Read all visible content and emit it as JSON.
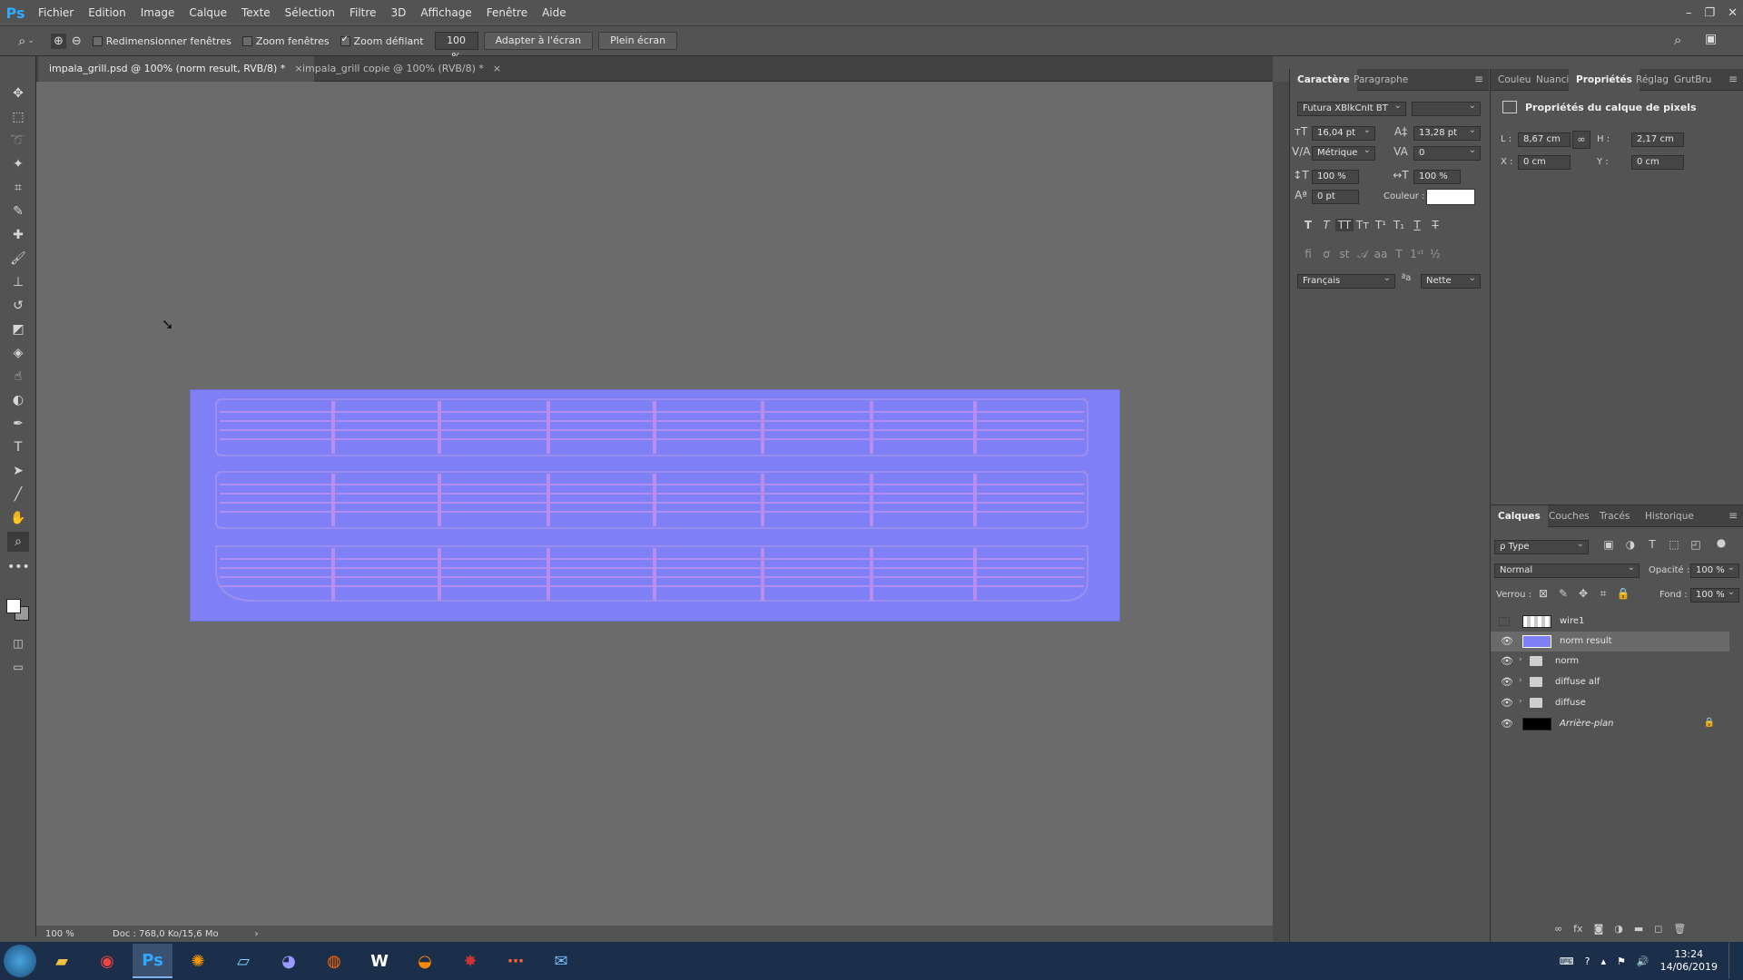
{
  "app": {
    "logo": "Ps"
  },
  "menu": [
    "Fichier",
    "Edition",
    "Image",
    "Calque",
    "Texte",
    "Sélection",
    "Filtre",
    "3D",
    "Affichage",
    "Fenêtre",
    "Aide"
  ],
  "window_controls": {
    "minimize": "–",
    "restore": "❐",
    "close": "✕"
  },
  "options": {
    "resize_windows": "Redimensionner fenêtres",
    "resize_windows_checked": false,
    "zoom_all": "Zoom fenêtres",
    "zoom_all_checked": false,
    "scrubby": "Zoom défilant",
    "scrubby_checked": true,
    "zoom_value": "100 %",
    "fit_screen": "Adapter à l'écran",
    "fill_screen": "Plein écran"
  },
  "tabs": [
    {
      "label": "impala_grill.psd @ 100% (norm result, RVB/8) *",
      "close": "×"
    },
    {
      "label": "impala_grill copie @ 100% (RVB/8) *",
      "close": "×"
    }
  ],
  "status": {
    "zoom": "100 %",
    "doc": "Doc : 768,0 Ko/15,6 Mo",
    "arrow": "›"
  },
  "character": {
    "tabs": [
      "Caractère",
      "Paragraphe"
    ],
    "font": "Futura XBlkCnIt BT",
    "size": "16,04 pt",
    "leading": "13,28 pt",
    "kerning": "Métrique",
    "tracking": "0",
    "vscale": "100 %",
    "hscale": "100 %",
    "baseline": "0 pt",
    "color_label": "Couleur :",
    "color": "#ffffff",
    "language": "Français",
    "aa_icon": "ªa",
    "antialias": "Nette"
  },
  "properties": {
    "tabs": [
      "Couleu",
      "Nuanci",
      "Propriétés",
      "Réglag",
      "GrutBru"
    ],
    "title": "Propriétés du calque de pixels",
    "w_label": "L :",
    "w": "8,67 cm",
    "h_label": "H :",
    "h": "2,17 cm",
    "x_label": "X :",
    "x": "0 cm",
    "y_label": "Y :",
    "y": "0 cm"
  },
  "layers": {
    "tabs": [
      "Calques",
      "Couches",
      "Tracés",
      "Historique"
    ],
    "filter": "ρ Type",
    "blend": "Normal",
    "opacity_label": "Opacité :",
    "opacity": "100 %",
    "lock_label": "Verrou :",
    "fill_label": "Fond :",
    "fill": "100 %",
    "items": [
      {
        "name": "wire1",
        "visible": false,
        "kind": "pixel"
      },
      {
        "name": "norm result",
        "visible": true,
        "kind": "pixel",
        "selected": true
      },
      {
        "name": "norm",
        "visible": true,
        "kind": "group"
      },
      {
        "name": "diffuse alf",
        "visible": true,
        "kind": "group"
      },
      {
        "name": "diffuse",
        "visible": true,
        "kind": "group"
      },
      {
        "name": "Arrière-plan",
        "visible": true,
        "kind": "background",
        "locked": true
      }
    ]
  },
  "taskbar": {
    "apps": [
      "start",
      "explorer",
      "chrome",
      "Ps",
      "firefox-alt",
      "notes",
      "discord",
      "firefox",
      "W",
      "blender",
      "game",
      "share",
      "mail"
    ],
    "time": "13:24",
    "date": "14/06/2019"
  }
}
